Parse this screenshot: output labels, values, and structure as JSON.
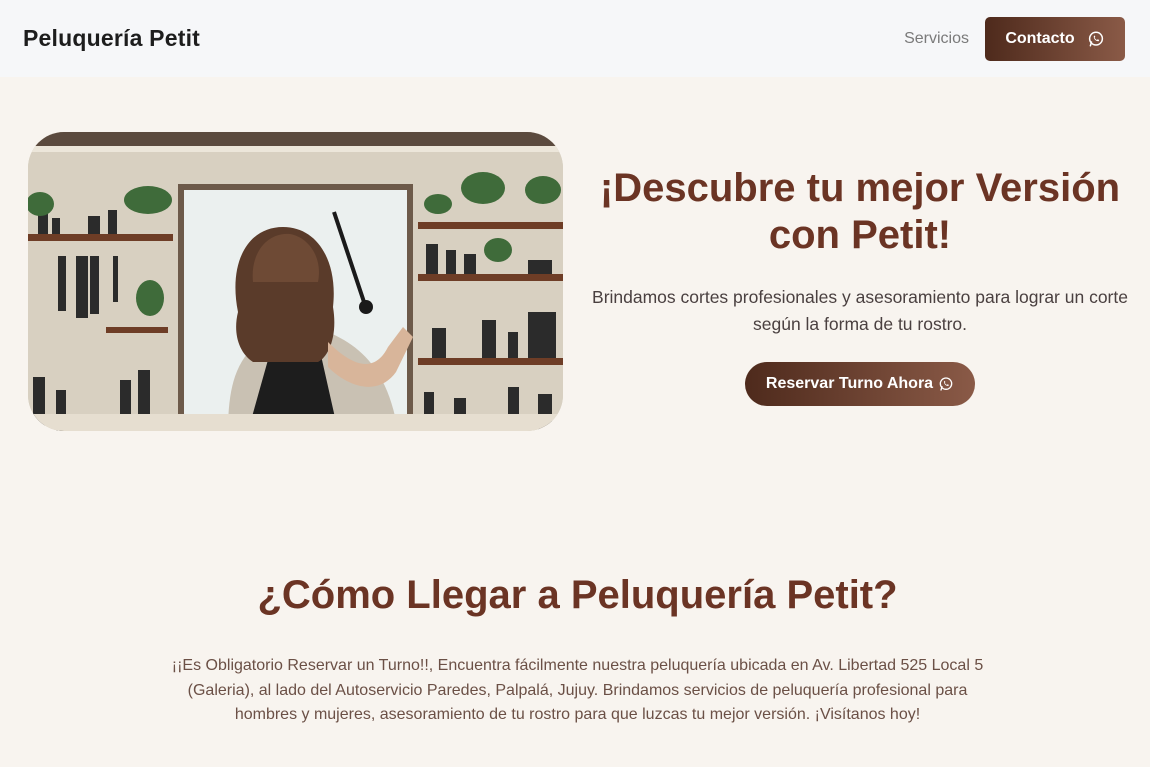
{
  "navbar": {
    "brand": "Peluquería Petit",
    "services_link": "Servicios",
    "contact_button": "Contacto",
    "contact_icon": "whatsapp-icon"
  },
  "hero": {
    "image_alt": "Peluquera en un salón con estanterías de productos",
    "title": "¡Descubre tu mejor Versión con Petit!",
    "description": "Brindamos cortes profesionales y asesoramiento para lograr un corte según la forma de tu rostro.",
    "cta_button": "Reservar Turno Ahora",
    "cta_icon": "whatsapp-icon"
  },
  "location": {
    "title": "¿Cómo Llegar a Peluquería Petit?",
    "description": "¡¡Es Obligatorio Reservar un Turno!!, Encuentra fácilmente nuestra peluquería ubicada en Av. Libertad 525 Local 5 (Galeria), al lado del Autoservicio Paredes, Palpalá, Jujuy. Brindamos servicios de peluquería profesional para hombres y mujeres, asesoramiento de tu rostro para que luzcas tu mejor versión. ¡Visítanos hoy!"
  },
  "colors": {
    "background": "#f8f4ef",
    "navbar": "#f6f7f9",
    "accent_title": "#6b3424",
    "button_start": "#4e2a1c",
    "button_end": "#8a5a47"
  }
}
